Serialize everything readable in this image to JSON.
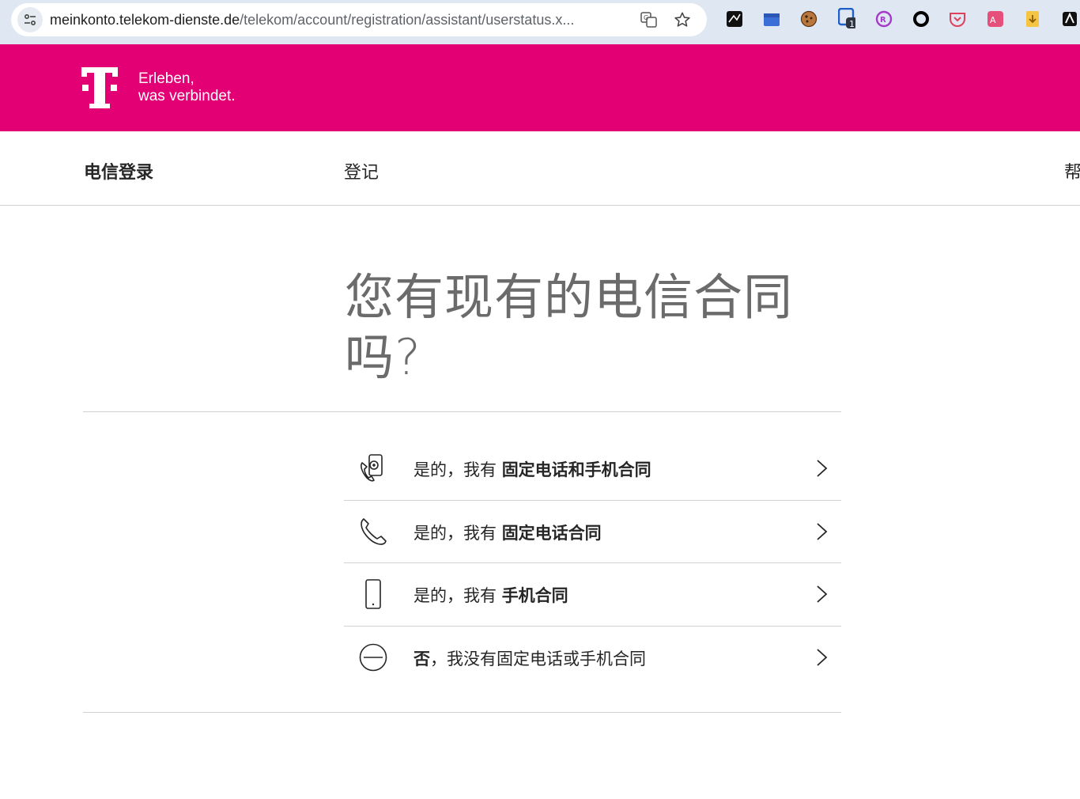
{
  "browser": {
    "url_host": "meinkonto.telekom-dienste.de",
    "url_path": "/telekom/account/registration/assistant/userstatus.x..."
  },
  "brand": {
    "slogan_line1": "Erleben,",
    "slogan_line2": "was verbindet.",
    "color": "#e20074"
  },
  "subnav": {
    "title": "电信登录",
    "link": "登记",
    "help": "帮"
  },
  "question": "您有现有的电信合同吗?",
  "options": [
    {
      "icon": "landline-and-mobile-icon",
      "prefix": "是的，我有 ",
      "bold": "固定电话和手机合同",
      "suffix": ""
    },
    {
      "icon": "landline-phone-icon",
      "prefix": "是的，我有 ",
      "bold": "固定电话合同",
      "suffix": ""
    },
    {
      "icon": "mobile-phone-icon",
      "prefix": "是的，我有 ",
      "bold": "手机合同",
      "suffix": ""
    },
    {
      "icon": "minus-circle-icon",
      "prefix": "",
      "bold": "否",
      "suffix": "，我没有固定电话或手机合同"
    }
  ]
}
